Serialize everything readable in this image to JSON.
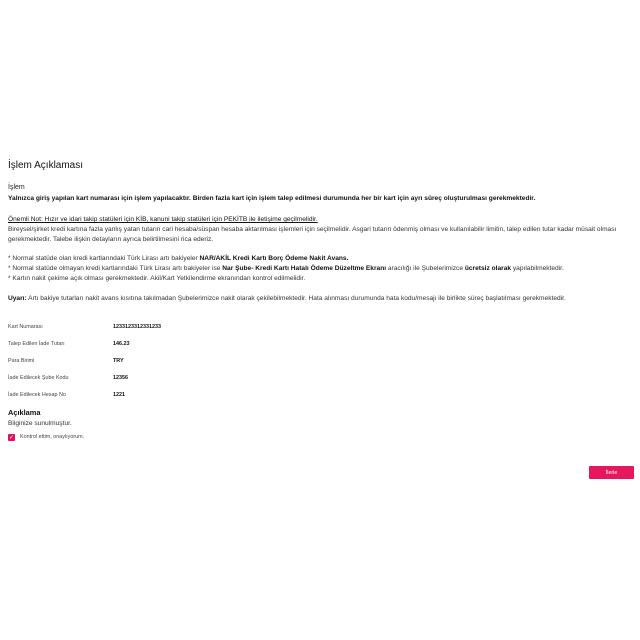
{
  "page": {
    "title": "İşlem Açıklaması",
    "section_label": "İşlem",
    "intro_bold": "Yalnızca giriş yapılan kart numarası için işlem yapılacaktır. Birden fazla kart için işlem talep edilmesi durumunda her bir kart için ayrı süreç oluşturulması gerekmektedir.",
    "note_heading": "Önemli Not: Hızır ve idari takip statüleri için KİB, kanuni takip statüleri için PEKİTB ile iletişime geçilmelidir.",
    "note_paragraph": "Bireysel/şirket kredi kartına fazla yanlış yatan tutarın cari hesaba/süspan hesaba aktarılması işlemleri için seçilmelidir. Asgari tutarın ödenmiş olması ve kullanılabilir limitin, talep edilen tutar kadar müsait olması gerekmektedir. Talebe ilişkin detayların ayrıca belirtilmesini rica ederiz.",
    "bullets": [
      {
        "pre": "* Normal statüde olan kredi kartlarındaki Türk Lirası artı bakiyeler ",
        "bold": "NAR/AKİL Kredi Kartı Borç Ödeme Nakit Avans.",
        "mid": "",
        "bold2": "",
        "post": ""
      },
      {
        "pre": "* Normal statüde olmayan kredi kartlarındaki Türk Lirası artı bakiyeler ise ",
        "bold": "Nar Şube- Kredi Kartı Hatalı Ödeme Düzeltme Ekranı",
        "mid": " aracılığı ile Şubelerimizce ",
        "bold2": "ücretsiz olarak",
        "post": " yapılabilmektedir."
      },
      {
        "pre": "* Kartın nakit çekime açık olması gerekmektedir. Akil/Kart Yetkilendirme ekranından kontrol edilmelidir.",
        "bold": "",
        "mid": "",
        "bold2": "",
        "post": ""
      }
    ],
    "warning_label": "Uyarı:",
    "warning_text": " Artı bakiye tutarları nakit avans kısıtına takılmadan Şubelerimizce nakit olarak çekilebilmektedir. Hata alınması durumunda hata kodu/mesajı ile birlikte süreç başlatılması gerekmektedir."
  },
  "details": [
    {
      "label": "Kart Numarası",
      "value": "1233123312331233"
    },
    {
      "label": "Talep Edilen İade Tutarı",
      "value": "146.23"
    },
    {
      "label": "Para Birimi",
      "value": "TRY"
    },
    {
      "label": "İade Edilecek Şube Kodu",
      "value": "12356"
    },
    {
      "label": "İade Edilecek Hesap No",
      "value": "1221"
    }
  ],
  "description": {
    "title": "Açıklama",
    "text": "Bilginize sunulmuştur."
  },
  "confirm": {
    "label": "Kontrol ettim, onaylıyorum.",
    "checked": true,
    "check_color": "#e0115f"
  },
  "actions": {
    "submit_label": "İlerle",
    "submit_color": "#e8175d"
  }
}
